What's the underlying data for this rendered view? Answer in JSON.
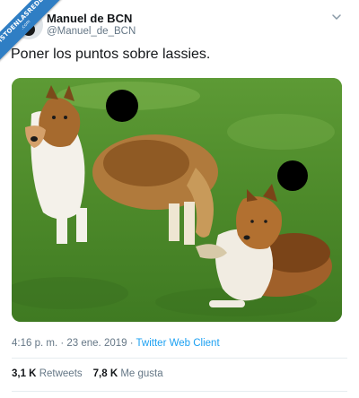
{
  "watermark": {
    "line1": "VISTOENLASREDES",
    "line2": ".com"
  },
  "author": {
    "name": "Manuel de BCN",
    "handle": "@Manuel_de_BCN"
  },
  "tweet": {
    "text": "Poner los puntos sobre lassies."
  },
  "meta": {
    "time": "4:16 p. m.",
    "separator": " · ",
    "date": "23 ene. 2019",
    "client": "Twitter Web Client"
  },
  "stats": {
    "retweets_count": "3,1 K",
    "retweets_label": "Retweets",
    "likes_count": "7,8 K",
    "likes_label": "Me gusta"
  },
  "colors": {
    "link": "#1da1f2",
    "muted": "#657786",
    "ribbon": "#2f7ec4"
  }
}
